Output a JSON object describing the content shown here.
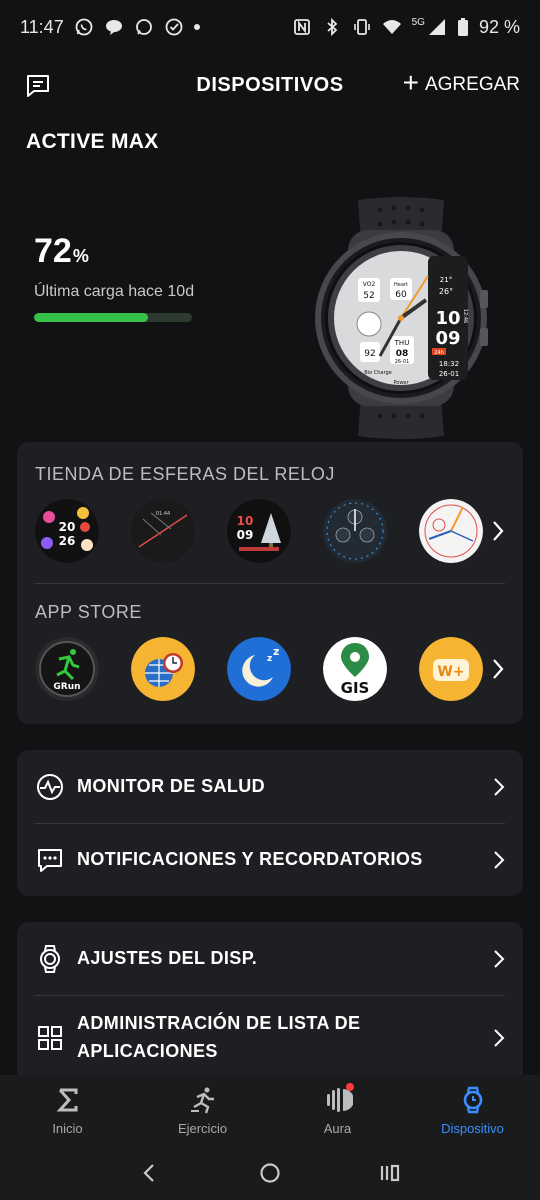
{
  "status_bar": {
    "time": "11:47",
    "network": "5G",
    "battery": "92 %"
  },
  "header": {
    "title": "DISPOSITIVOS",
    "add_label": "AGREGAR"
  },
  "device": {
    "name": "ACTIVE MAX",
    "battery_percent": "72",
    "battery_unit": "%",
    "battery_fraction": 0.72,
    "last_charge_label": "Última carga hace 10d"
  },
  "watch_face": {
    "top_left_label": "VO2",
    "top_left_value": "52",
    "heart_label": "Heart",
    "heart_value": "60",
    "time_hour": "10",
    "time_minute": "09",
    "side_time": "18:32",
    "side_date": "26-01",
    "weather": "26°",
    "weather_range": "21°",
    "battery_value": "92",
    "day": "THU",
    "date_value": "08",
    "date_sub": "26-01",
    "bio_label": "Bio Charge",
    "power_label": "Power",
    "side_badge": "12:46",
    "red_badge": "24h"
  },
  "store": {
    "faces_title": "TIENDA DE ESFERAS DEL RELOJ",
    "apps_title": "APP STORE",
    "faces": [
      {
        "name": "face-2026",
        "text1": "20",
        "text2": "26"
      },
      {
        "name": "face-dark-stripes",
        "text1": "01:44"
      },
      {
        "name": "face-christmas",
        "text1": "10",
        "text2": "09"
      },
      {
        "name": "face-blue-chrono"
      },
      {
        "name": "face-white-analog"
      }
    ],
    "apps": [
      {
        "name": "grun",
        "label": "GRun"
      },
      {
        "name": "world-clock"
      },
      {
        "name": "sleep"
      },
      {
        "name": "gis",
        "label": "GIS"
      },
      {
        "name": "w-plus",
        "label": "W+"
      }
    ]
  },
  "menu": {
    "health_monitor": "MONITOR DE SALUD",
    "notifications": "NOTIFICACIONES Y RECORDATORIOS",
    "device_settings": "AJUSTES DEL DISP.",
    "app_list_line1": "ADMINISTRACIÓN DE LISTA DE",
    "app_list_line2": "APLICACIONES"
  },
  "bottom_nav": {
    "home": "Inicio",
    "exercise": "Ejercicio",
    "aura": "Aura",
    "device": "Dispositivo"
  },
  "colors": {
    "accent": "#3c8dff",
    "battery_green": "#36c24a",
    "card_bg": "#1e1f22",
    "background": "#111214"
  }
}
